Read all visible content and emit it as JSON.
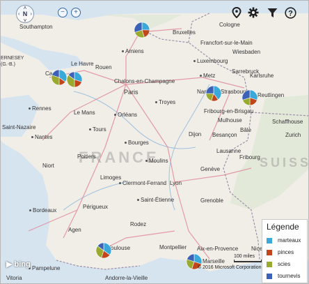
{
  "toolbar": {
    "compass_label": "N",
    "zoom_out": "⊖",
    "zoom_in": "⊕"
  },
  "country_labels": [
    "FRANCE",
    "SUISSE"
  ],
  "ocean_labels": [
    "ERNESEY",
    "(G.-B.)"
  ],
  "cities": [
    {
      "name": "Southampton"
    },
    {
      "name": "Cologne"
    },
    {
      "name": "Bruxelles"
    },
    {
      "name": "Francfort-sur-le-Main"
    },
    {
      "name": "Wiesbaden"
    },
    {
      "name": "Amiens"
    },
    {
      "name": "Luxembourg"
    },
    {
      "name": "Le Havre"
    },
    {
      "name": "Rouen"
    },
    {
      "name": "Sarrebruck"
    },
    {
      "name": "Metz"
    },
    {
      "name": "Karlsruhe"
    },
    {
      "name": "Chalons-en-Champagne"
    },
    {
      "name": "Caen"
    },
    {
      "name": "Paris"
    },
    {
      "name": "Nancy"
    },
    {
      "name": "Strasbourg"
    },
    {
      "name": "Reutlingen"
    },
    {
      "name": "Rennes"
    },
    {
      "name": "Troyes"
    },
    {
      "name": "Le Mans"
    },
    {
      "name": "Orléans"
    },
    {
      "name": "Fribourg-en-Brisgau"
    },
    {
      "name": "Mulhouse"
    },
    {
      "name": "Nantes"
    },
    {
      "name": "Tours"
    },
    {
      "name": "Dijon"
    },
    {
      "name": "Besançon"
    },
    {
      "name": "Bâle"
    },
    {
      "name": "Schaffhouse"
    },
    {
      "name": "Zurich"
    },
    {
      "name": "Bourges"
    },
    {
      "name": "Poitiers"
    },
    {
      "name": "Moulins"
    },
    {
      "name": "Lausanne"
    },
    {
      "name": "Niort"
    },
    {
      "name": "Fribourg"
    },
    {
      "name": "Genève"
    },
    {
      "name": "Limoges"
    },
    {
      "name": "Clermont-Ferrand"
    },
    {
      "name": "Lyon"
    },
    {
      "name": "Périgueux"
    },
    {
      "name": "Saint-Étienne"
    },
    {
      "name": "Grenoble"
    },
    {
      "name": "Bordeaux"
    },
    {
      "name": "Agen"
    },
    {
      "name": "Rodez"
    },
    {
      "name": "Toulouse"
    },
    {
      "name": "Montpellier"
    },
    {
      "name": "Aix-en-Provence"
    },
    {
      "name": "Marseille"
    },
    {
      "name": "Pampelune"
    },
    {
      "name": "Vitoria"
    },
    {
      "name": "Andorre-la-Vieille"
    },
    {
      "name": "Saint-Nazaire"
    },
    {
      "name": "Nice"
    }
  ],
  "legend": {
    "title": "Légende",
    "items": [
      {
        "label": "marteaux",
        "color": "#3aa9d9"
      },
      {
        "label": "pinces",
        "color": "#c1461c"
      },
      {
        "label": "scies",
        "color": "#9aaa2e"
      },
      {
        "label": "tournevis",
        "color": "#3b62b6"
      }
    ]
  },
  "pies": [
    {
      "name": "pie-bruxelles",
      "values": [
        25,
        20,
        25,
        30
      ]
    },
    {
      "name": "pie-caen",
      "values": [
        35,
        15,
        30,
        20
      ]
    },
    {
      "name": "pie-rouen",
      "values": [
        30,
        20,
        35,
        15
      ]
    },
    {
      "name": "pie-nancy",
      "values": [
        40,
        15,
        20,
        25
      ]
    },
    {
      "name": "pie-strasbourg",
      "values": [
        30,
        20,
        20,
        30
      ]
    },
    {
      "name": "pie-toulouse",
      "values": [
        35,
        20,
        30,
        15
      ]
    },
    {
      "name": "pie-marseille",
      "values": [
        30,
        25,
        25,
        20
      ]
    }
  ],
  "footer": {
    "bing": "bing",
    "copyright": "© 2016 Microsoft Corporation",
    "scale": "100 miles"
  }
}
